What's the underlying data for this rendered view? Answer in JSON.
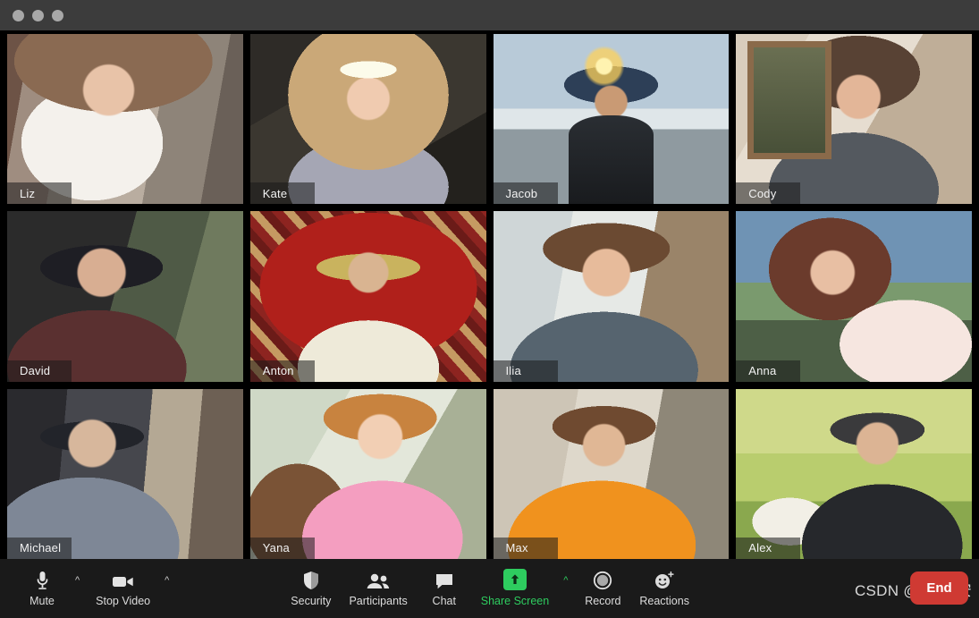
{
  "window": {
    "traffic_lights": [
      "close",
      "minimize",
      "maximize"
    ]
  },
  "gallery": {
    "participants": [
      {
        "name": "Liz",
        "theme": "v-liz"
      },
      {
        "name": "Kate",
        "theme": "v-kate"
      },
      {
        "name": "Jacob",
        "theme": "v-jacob"
      },
      {
        "name": "Cody",
        "theme": "v-cody"
      },
      {
        "name": "David",
        "theme": "v-david"
      },
      {
        "name": "Anton",
        "theme": "v-anton"
      },
      {
        "name": "Ilia",
        "theme": "v-ilia"
      },
      {
        "name": "Anna",
        "theme": "v-anna"
      },
      {
        "name": "Michael",
        "theme": "v-michael"
      },
      {
        "name": "Yana",
        "theme": "v-yana"
      },
      {
        "name": "Max",
        "theme": "v-max"
      },
      {
        "name": "Alex",
        "theme": "v-alex"
      }
    ]
  },
  "toolbar": {
    "mute_label": "Mute",
    "mute_icon": "microphone-icon",
    "mute_caret": "^",
    "stop_video_label": "Stop Video",
    "stop_video_icon": "video-camera-icon",
    "stop_video_caret": "^",
    "security_label": "Security",
    "security_icon": "shield-icon",
    "participants_label": "Participants",
    "participants_icon": "people-icon",
    "chat_label": "Chat",
    "chat_icon": "speech-bubble-icon",
    "share_screen_label": "Share Screen",
    "share_screen_icon": "up-arrow-box-icon",
    "share_screen_caret": "^",
    "record_label": "Record",
    "record_icon": "record-circle-icon",
    "reactions_label": "Reactions",
    "reactions_icon": "smiley-plus-icon",
    "end_label": "End"
  },
  "watermark": {
    "text": "CSDN @Mr.长安"
  },
  "colors": {
    "share_screen_green": "#2ecc5f",
    "end_red": "#cf3a33",
    "toolbar_bg": "#1a1a1a",
    "titlebar_bg": "#3c3c3c"
  }
}
